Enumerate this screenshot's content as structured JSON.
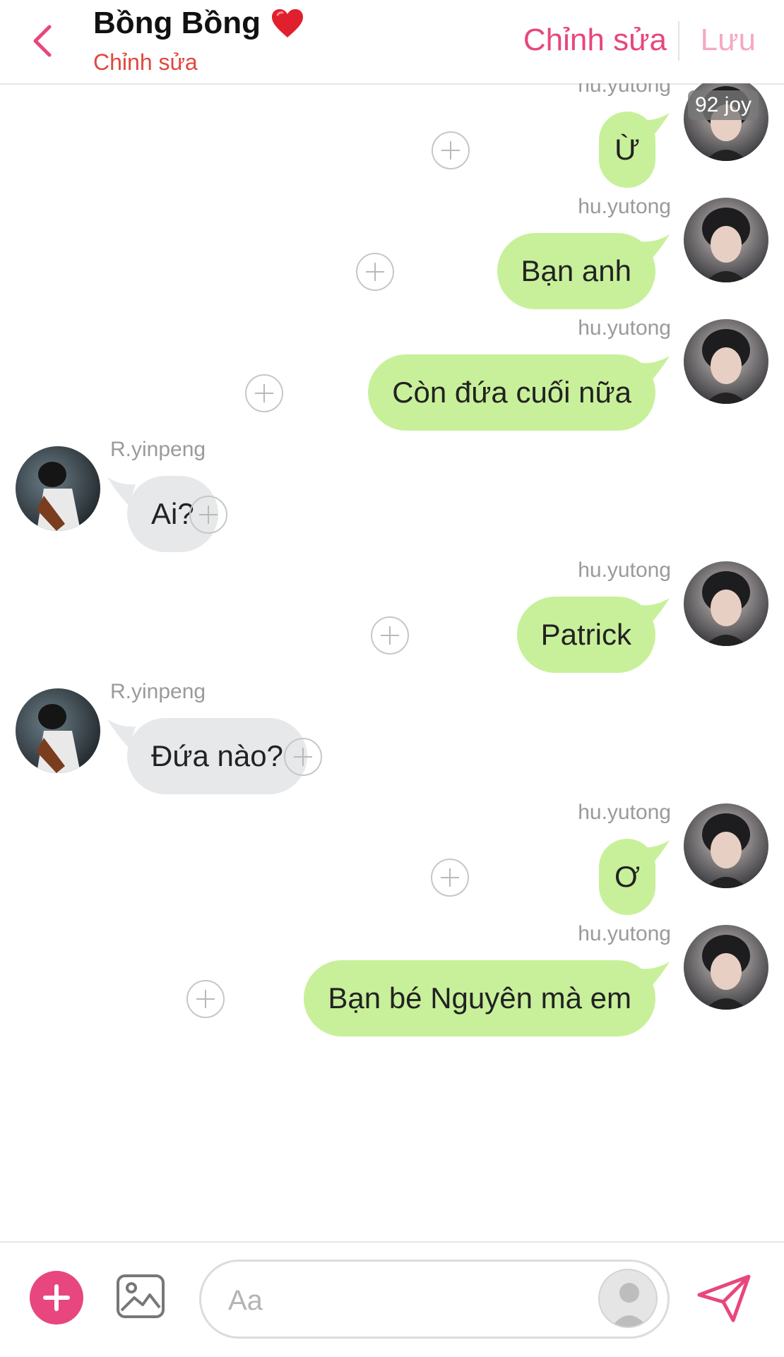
{
  "header": {
    "title": "Bồng Bồng",
    "subtitle": "Chỉnh sửa",
    "edit_label": "Chỉnh sửa",
    "save_label": "Lưu"
  },
  "messages": [
    {
      "side": "right",
      "sender": "hu.yutong",
      "text": "Ừ",
      "badge": "92 joy"
    },
    {
      "side": "right",
      "sender": "hu.yutong",
      "text": "Bạn anh"
    },
    {
      "side": "right",
      "sender": "hu.yutong",
      "text": "Còn đứa cuối nữa"
    },
    {
      "side": "left",
      "sender": "R.yinpeng",
      "text": "Ai?"
    },
    {
      "side": "right",
      "sender": "hu.yutong",
      "text": "Patrick"
    },
    {
      "side": "left",
      "sender": "R.yinpeng",
      "text": "Đứa nào?"
    },
    {
      "side": "right",
      "sender": "hu.yutong",
      "text": "Ơ"
    },
    {
      "side": "right",
      "sender": "hu.yutong",
      "text": "Bạn bé Nguyên mà em"
    }
  ],
  "composer": {
    "placeholder": "Aa"
  },
  "colors": {
    "accent": "#e8467f",
    "outgoing_bubble": "#c8f09a",
    "incoming_bubble": "#e6e8ea",
    "subtitle": "#e0483e"
  },
  "icons": [
    "back-chevron-icon",
    "heart-icon",
    "add-icon",
    "image-icon",
    "user-placeholder-icon",
    "send-icon",
    "plus-circle-icon"
  ]
}
